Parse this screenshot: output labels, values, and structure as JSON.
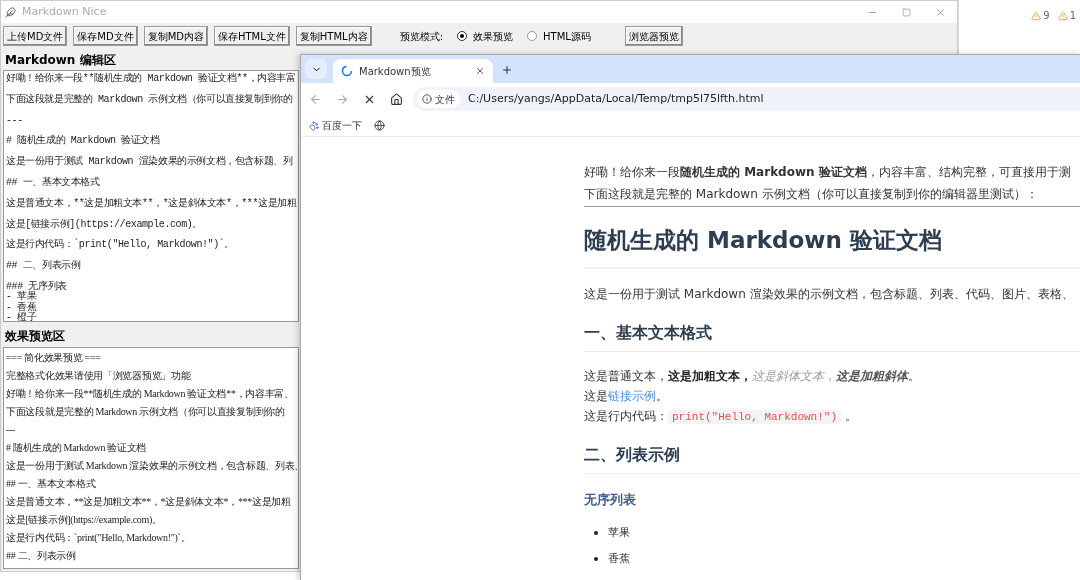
{
  "app_window": {
    "title": "Markdown Nice",
    "toolbar": {
      "buttons": [
        "上传MD文件",
        "保存MD文件",
        "复制MD内容",
        "保存HTML文件",
        "复制HTML内容"
      ],
      "mode_label": "预览模式:",
      "modes": [
        {
          "label": "效果预览",
          "selected": true
        },
        {
          "label": "HTML源码",
          "selected": false
        }
      ],
      "browser_button": "浏览器预览"
    },
    "editor": {
      "heading": "Markdown 编辑区",
      "paragraphs": [
        [
          "好嘞！给你来一段**随机生成的 Markdown 验证文档**，内容丰富"
        ],
        [
          "下面这段就是完整的 Markdown 示例文档（你可以直接复制到你的"
        ],
        [
          "---"
        ],
        [
          "# 随机生成的 Markdown 验证文档"
        ],
        [
          "这是一份用于测试 Markdown 渲染效果的示例文档，包含标题、列"
        ],
        [
          "## 一、基本文本格式"
        ],
        [
          "这是普通文本，**这是加粗文本**，*这是斜体文本*，***这是加粗"
        ],
        [
          "这是[链接示例](https://example.com)。"
        ],
        [
          "这是行内代码：`print(\"Hello, Markdown!\")`。"
        ],
        [
          "## 二、列表示例"
        ],
        [
          "### 无序列表",
          "- 苹果",
          "- 香蕉",
          "- 橙子"
        ]
      ]
    },
    "preview": {
      "heading": "效果预览区",
      "lines": [
        "=== 简化效果预览 ===",
        "完整格式化效果请使用「浏览器预览」功能",
        "好嘞！给你来一段**随机生成的 Markdown 验证文档**，内容丰富、",
        "下面这段就是完整的 Markdown 示例文档（你可以直接复制到你的",
        "---",
        "# 随机生成的 Markdown 验证文档",
        "这是一份用于测试 Markdown 渲染效果的示例文档，包含标题、列表、",
        "## 一、基本文本格式",
        "这是普通文本，**这是加粗文本**，*这是斜体文本*，***这是加粗",
        "这是[链接示例](https://example.com)。",
        "这是行内代码：`print(\"Hello, Markdown!\")`。",
        "## 二、列表示例"
      ]
    }
  },
  "browser": {
    "tabs": [
      {
        "title": "Markdown预览",
        "selected": true
      }
    ],
    "address_chip": "文件",
    "url": "C:/Users/yangs/AppData/Local/Temp/tmp5l75lfth.html",
    "bookmarks": [
      {
        "label": "百度一下"
      }
    ],
    "page": {
      "intro": [
        "好嘞！给你来一段**随机生成的 Markdown 验证文档**，内容丰富、结构完整，可直接用于测",
        "下面这段就是完整的 Markdown 示例文档（你可以直接复制到你的编辑器里测试）："
      ],
      "title": "随机生成的 Markdown 验证文档",
      "lead": "这是一份用于测试 Markdown 渲染效果的示例文档，包含标题、列表、代码、图片、表格、",
      "sections": [
        {
          "heading": "一、基本文本格式",
          "lines": [
            {
              "kind": "segments",
              "segments": [
                {
                  "kind": "plain",
                  "text": "这是普通文本，"
                },
                {
                  "kind": "bold",
                  "text": "这是加粗文本，"
                },
                {
                  "kind": "italic",
                  "text": "这是斜体文本，"
                },
                {
                  "kind": "bold_italic",
                  "text": "这是加粗斜体"
                },
                {
                  "kind": "plain",
                  "text": "。"
                }
              ]
            },
            {
              "kind": "segments",
              "segments": [
                {
                  "kind": "plain",
                  "text": "这是"
                },
                {
                  "kind": "link",
                  "text": "链接示例"
                },
                {
                  "kind": "plain",
                  "text": "。"
                }
              ]
            },
            {
              "kind": "segments",
              "segments": [
                {
                  "kind": "plain",
                  "text": "这是行内代码："
                },
                {
                  "kind": "code",
                  "text": "print(\"Hello, Markdown!\")"
                },
                {
                  "kind": "plain",
                  "text": " 。"
                }
              ]
            }
          ]
        },
        {
          "heading": "二、列表示例",
          "subheading": "无序列表",
          "items": [
            "苹果",
            "香蕉"
          ]
        }
      ]
    }
  },
  "background_app": {
    "badges": [
      {
        "count": "9"
      },
      {
        "count": "1"
      }
    ]
  }
}
